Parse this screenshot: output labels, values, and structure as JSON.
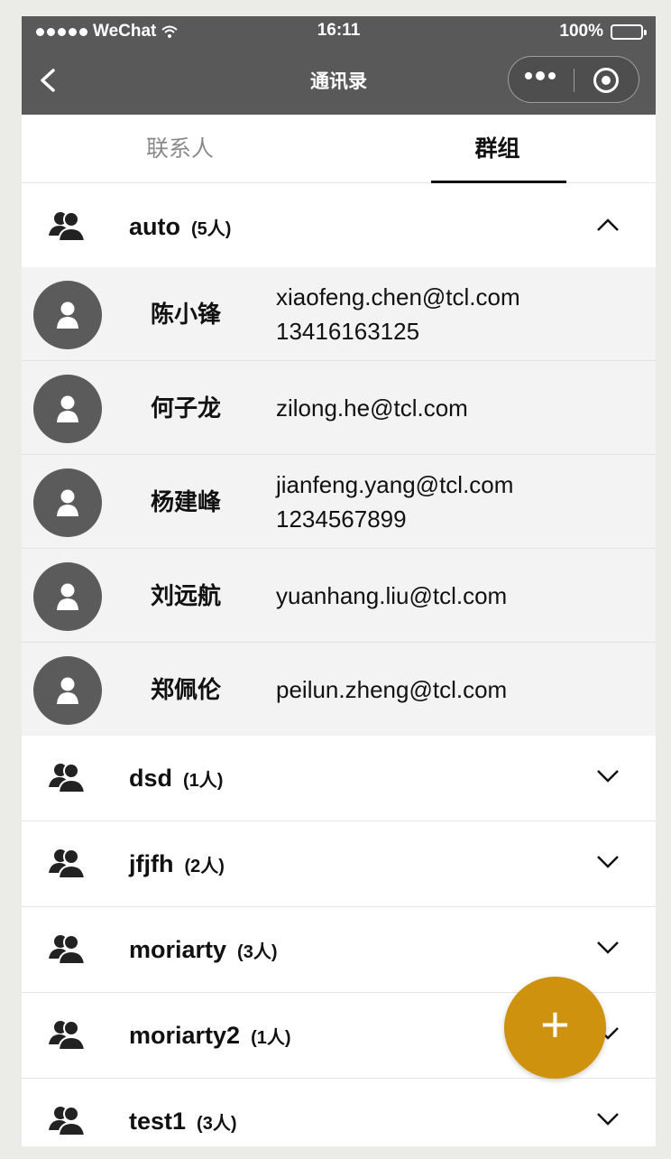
{
  "status_bar": {
    "carrier": "WeChat",
    "time": "16:11",
    "battery": "100%"
  },
  "nav": {
    "title": "通讯录"
  },
  "tabs": [
    {
      "label": "联系人",
      "active": false
    },
    {
      "label": "群组",
      "active": true
    }
  ],
  "groups": [
    {
      "name": "auto",
      "count": "(5人)",
      "expanded": true
    },
    {
      "name": "dsd",
      "count": "(1人)",
      "expanded": false
    },
    {
      "name": "jfjfh",
      "count": "(2人)",
      "expanded": false
    },
    {
      "name": "moriarty",
      "count": "(3人)",
      "expanded": false
    },
    {
      "name": "moriarty2",
      "count": "(1人)",
      "expanded": false
    },
    {
      "name": "test1",
      "count": "(3人)",
      "expanded": false
    }
  ],
  "members": [
    {
      "name": "陈小锋",
      "email": "xiaofeng.chen@tcl.com",
      "phone": "13416163125"
    },
    {
      "name": "何子龙",
      "email": "zilong.he@tcl.com",
      "phone": ""
    },
    {
      "name": "杨建峰",
      "email": "jianfeng.yang@tcl.com",
      "phone": "1234567899"
    },
    {
      "name": "刘远航",
      "email": "yuanhang.liu@tcl.com",
      "phone": ""
    },
    {
      "name": "郑佩伦",
      "email": "peilun.zheng@tcl.com",
      "phone": ""
    }
  ],
  "fab": {
    "label": "+"
  },
  "colors": {
    "nav_bg": "#595959",
    "member_bg": "#f3f3f3",
    "avatar_bg": "#5b5b5b",
    "fab_bg": "#cf920e"
  },
  "icons": {
    "back": "chevron-left-icon",
    "more": "more-dots-icon",
    "close": "target-icon",
    "group": "group-users-icon",
    "avatar": "person-icon",
    "expand": "chevron-down-icon",
    "collapse": "chevron-up-icon"
  }
}
